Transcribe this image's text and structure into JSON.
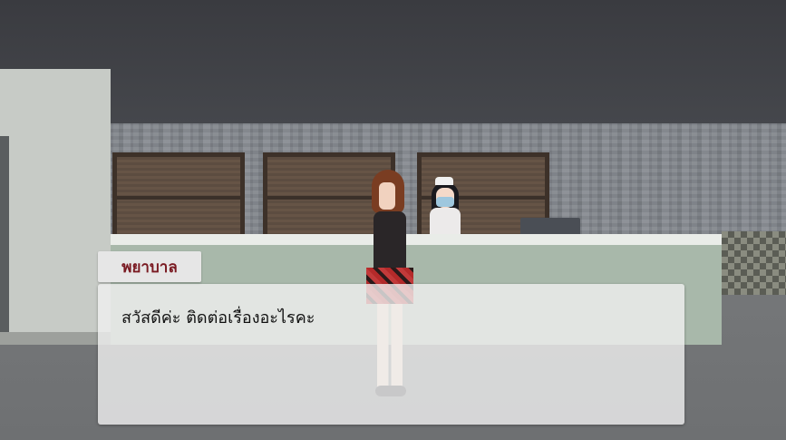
{
  "dialogue": {
    "speaker": "พยาบาล",
    "text": "สวัสดีค่ะ ติดต่อเรื่องอะไรคะ"
  },
  "scene": {
    "characters": [
      "student-girl",
      "nurse"
    ],
    "colors": {
      "speaker_name": "#7a1a22",
      "dialogue_box": "#f0f0f0",
      "name_plate": "#e6e6e6"
    }
  }
}
